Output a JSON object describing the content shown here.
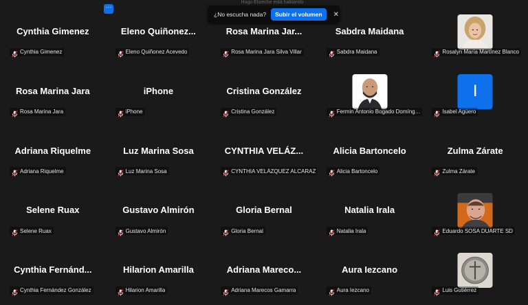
{
  "notification": {
    "message": "¿No escucha nada?",
    "button_label": "Subir el volumen",
    "close_glyph": "✕",
    "peek_text": "Hugo Elizeche está hablando"
  },
  "more_button": {
    "glyph": "⋯"
  },
  "participants": [
    {
      "display": "Cynthia Gimenez",
      "name": "Cynthia Gimenez"
    },
    {
      "display": "Eleno  Quiñonez...",
      "name": "Eleno Quiñonez Acevedo"
    },
    {
      "display": "Rosa Marina Jar...",
      "name": "Rosa Marina Jara Silva Villar"
    },
    {
      "display": "Sabdra Maidana",
      "name": "Sabdra Maidana"
    },
    {
      "display": "",
      "name": "Rosalyn María Martínez Blanco",
      "avatar": "photo-woman"
    },
    {
      "display": "Rosa Marina Jara",
      "name": "Rosa Marina Jara"
    },
    {
      "display": "iPhone",
      "name": "iPhone"
    },
    {
      "display": "Cristina González",
      "name": "Cristina González"
    },
    {
      "display": "",
      "name": "Fermin Antonio Bogado Domínguez",
      "avatar": "photo-man-bald"
    },
    {
      "display": "",
      "name": "Isabel Agüero",
      "avatar": "letter",
      "letter": "I"
    },
    {
      "display": "Adriana Riquelme",
      "name": "Adriana Riquelme"
    },
    {
      "display": "Luz Marina Sosa",
      "name": "Luz Marina Sosa"
    },
    {
      "display": "CYNTHIA  VELÁZ...",
      "name": "CYNTHIA VELÁZQUEZ ALCARAZ"
    },
    {
      "display": "Alicia Bartoncelo",
      "name": "Alicia Bartoncelo"
    },
    {
      "display": "Zulma Zárate",
      "name": "Zulma Zárate"
    },
    {
      "display": "Selene Ruax",
      "name": "Selene Ruax"
    },
    {
      "display": "Gustavo Almirón",
      "name": "Gustavo Almirón"
    },
    {
      "display": "Gloria Bernal",
      "name": "Gloria Bernal"
    },
    {
      "display": "Natalia Irala",
      "name": "Natalia Irala"
    },
    {
      "display": "",
      "name": "Eduardo SOSA DUARTE SD",
      "avatar": "photo-man-orange"
    },
    {
      "display": "Cynthia  Fernánd...",
      "name": "Cynthia Fernández González"
    },
    {
      "display": "Hilarion Amarilla",
      "name": "Hilarion Amarilla"
    },
    {
      "display": "Adriana  Mareco...",
      "name": "Adriana Marecos Gamarra"
    },
    {
      "display": "Aura Iezcano",
      "name": "Aura Iezcano"
    },
    {
      "display": "",
      "name": "Luis Gutiérrez",
      "avatar": "photo-emblem"
    }
  ],
  "icons": {
    "muted": "muted-mic-icon"
  },
  "colors": {
    "accent": "#0e71eb",
    "muted_red": "#e02828",
    "bg": "#1a1a1a"
  }
}
